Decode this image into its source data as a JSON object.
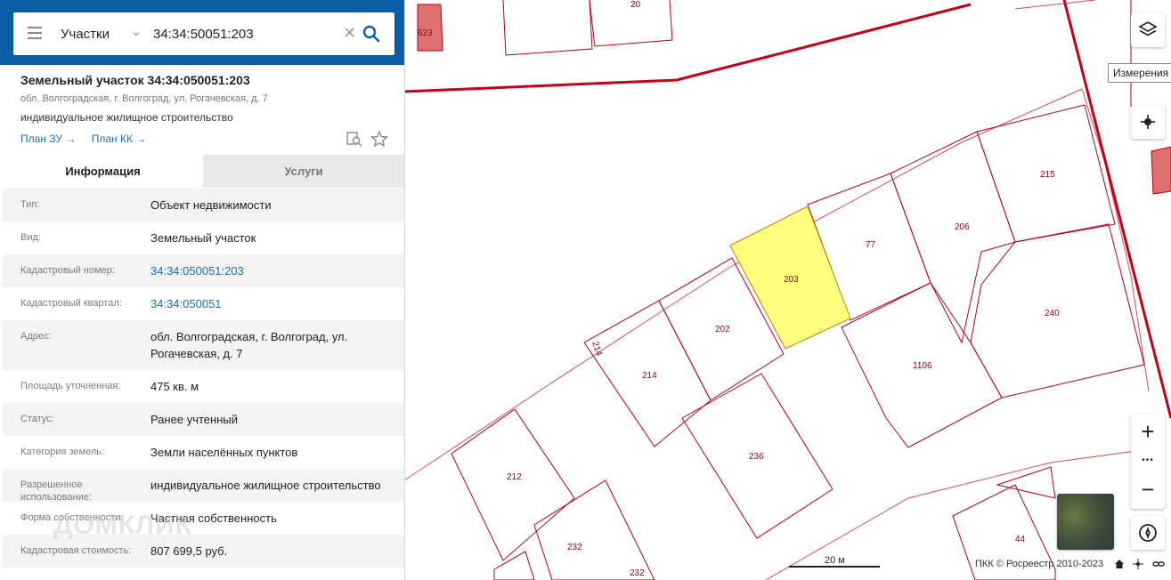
{
  "search": {
    "category": "Участки",
    "query": "34:34:50051:203"
  },
  "card": {
    "title": "Земельный участок 34:34:050051:203",
    "address": "обл. Волгоградская, г. Волгоград, ул. Рогачевская, д. 7",
    "purpose": "индивидуальное жилищное строительство",
    "link_plan_zu": "План ЗУ →",
    "link_plan_kk": "План КК →"
  },
  "tabs": {
    "info": "Информация",
    "services": "Услуги"
  },
  "rows": [
    {
      "label": "Тип:",
      "value": "Объект недвижимости"
    },
    {
      "label": "Вид:",
      "value": "Земельный участок"
    },
    {
      "label": "Кадастровый номер:",
      "value": "34:34:050051:203"
    },
    {
      "label": "Кадастровый квартал:",
      "value": "34:34:050051"
    },
    {
      "label": "Адрес:",
      "value": "обл. Волгоградская, г. Волгоград, ул. Рогачевская, д. 7"
    },
    {
      "label": "Площадь уточненная:",
      "value": "475 кв. м"
    },
    {
      "label": "Статус:",
      "value": "Ранее учтенный"
    },
    {
      "label": "Категория земель:",
      "value": "Земли населённых пунктов"
    },
    {
      "label": "Разрешенное использование:",
      "value": "индивидуальное жилищное строительство"
    },
    {
      "label": "Форма собственности:",
      "value": "Частная собственность"
    },
    {
      "label": "Кадастровая стоимость:",
      "value": "807 699,5 руб."
    }
  ],
  "watermark": "ДОМКЛИК",
  "map": {
    "parcel_labels": [
      "203",
      "77",
      "206",
      "215",
      "240",
      "202",
      "214",
      "1106",
      "236",
      "212",
      "232",
      "232",
      "44",
      "20",
      "623",
      "214"
    ],
    "tooltip": "Измерения",
    "scale_label": "20 м",
    "copyright": "ПКК © Росреестр 2010-2023",
    "zoom_in": "+",
    "zoom_out": "−",
    "more": "•••"
  },
  "colors": {
    "brand": "#0b5ea8",
    "selected_parcel": "#ffff80",
    "parcel_line": "#b0001a",
    "quarter_line": "#d05050"
  },
  "icons": {
    "menu": "burger-icon",
    "search": "search-icon",
    "clear": "close-icon",
    "layers": "layers-icon",
    "locate": "crosshair-icon",
    "compass": "compass-icon",
    "home": "home-icon"
  }
}
